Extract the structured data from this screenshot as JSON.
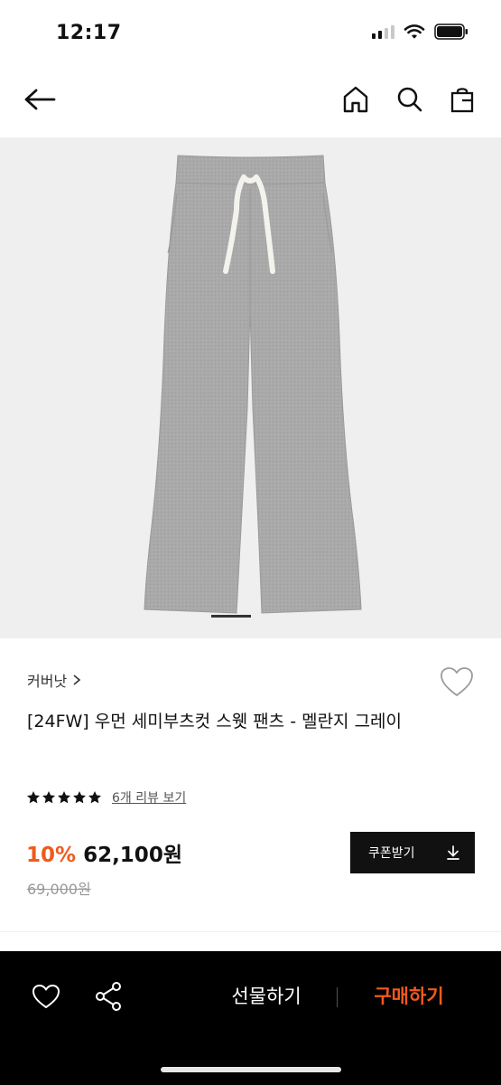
{
  "status_bar": {
    "time": "12:17"
  },
  "nav": {
    "icons": [
      "back-arrow-icon",
      "home-icon",
      "search-icon",
      "shopping-bag-icon"
    ]
  },
  "product": {
    "brand": "커버낫",
    "title": "[24FW] 우먼 세미부츠컷 스웻 팬츠 - 멜란지 그레이",
    "rating_stars": 5,
    "review_link": "6개 리뷰 보기",
    "discount": "10%",
    "price": "62,100원",
    "original_price": "69,000원",
    "coupon_label": "쿠폰받기",
    "image_carousel_position": 1
  },
  "bottom_bar": {
    "gift_label": "선물하기",
    "buy_label": "구매하기"
  },
  "colors": {
    "accent": "#f05a1e",
    "bottom_bar_bg": "#000000",
    "coupon_bg": "#111111",
    "image_bg": "#efefef",
    "pants": "#a9a9a9"
  }
}
